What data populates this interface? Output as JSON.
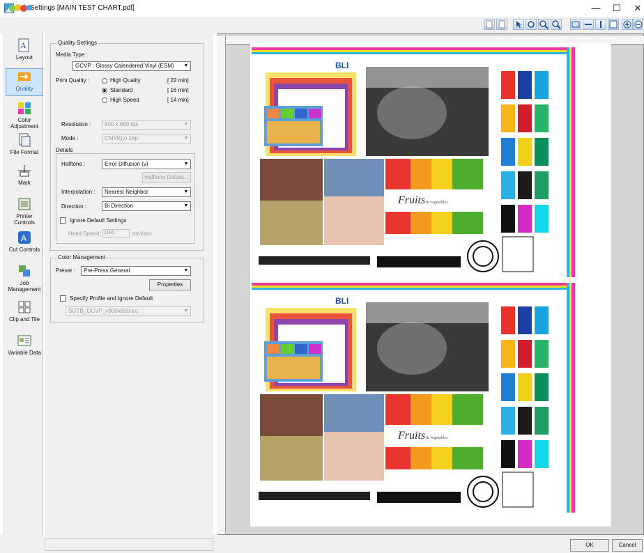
{
  "window": {
    "title": "Job Settings [MAIN TEST CHART.pdf]",
    "minimize": "—",
    "maximize": "☐",
    "close": "✕"
  },
  "toolbar": {
    "icons": [
      "page-prev-icon",
      "page-next-icon",
      "pointer-icon",
      "rotate-icon",
      "zoom-in-icon",
      "zoom-out-icon",
      "fit-page-icon",
      "fit-width-icon",
      "fit-height-icon",
      "grid-icon",
      "zoom-plus-icon",
      "zoom-minus-icon"
    ]
  },
  "sidebar": {
    "items": [
      {
        "label": "Layout",
        "icon": "layout-icon"
      },
      {
        "label": "Quality",
        "icon": "quality-icon",
        "selected": true
      },
      {
        "label": "Color Adjustment",
        "icon": "color-adjustment-icon"
      },
      {
        "label": "File Format",
        "icon": "file-format-icon"
      },
      {
        "label": "Mark",
        "icon": "mark-icon"
      },
      {
        "label": "Printer Controls",
        "icon": "printer-controls-icon"
      },
      {
        "label": "Cut Controls",
        "icon": "cut-controls-icon"
      },
      {
        "label": "Job Management",
        "icon": "job-management-icon"
      },
      {
        "label": "Clip and Tile",
        "icon": "clip-tile-icon"
      },
      {
        "label": "Variable Data",
        "icon": "variable-data-icon"
      }
    ]
  },
  "quality": {
    "group_title": "Quality Settings",
    "media_type_label": "Media Type :",
    "media_type_value": "GCVP : Glossy Calendered Vinyl (ESM)",
    "print_quality_label": "Print Quality :",
    "options": [
      {
        "label": "High Quality",
        "time": "[ 22 min]",
        "selected": false
      },
      {
        "label": "Standard",
        "time": "[ 16 min]",
        "selected": true
      },
      {
        "label": "High Speed",
        "time": "[ 14 min]",
        "selected": false
      }
    ],
    "resolution_label": "Resolution :",
    "resolution_value": "900 x 600 dpi",
    "mode_label": "Mode :",
    "mode_value": "CMYK(v) 16p",
    "details_title": "Details",
    "halftone_label": "Halftone :",
    "halftone_value": "Error Diffusion (v)",
    "halftone_button": "Halftone Details...",
    "interpolation_label": "Interpolation :",
    "interpolation_value": "Nearest Neighbor",
    "direction_label": "Direction :",
    "direction_value": "Bi Direction",
    "ignore_default": "Ignore Default Settings",
    "head_speed_label": "Head Speed:",
    "head_speed_value": "1185",
    "head_speed_unit": "mm/sec"
  },
  "color_management": {
    "group_title": "Color Management",
    "preset_label": "Preset :",
    "preset_value": "Pre-Press General",
    "properties_button": "Properties",
    "specify_profile": "Specify Profile and Ignore Default",
    "profile_value": "SGTB_GCVP_v900x600.icc"
  },
  "preview": {
    "sheets": [
      {
        "brand": "BLI",
        "fruits_text": "Fruits",
        "fruits_sub": "& vegetables"
      },
      {
        "brand": "BLI",
        "fruits_text": "Fruits",
        "fruits_sub": "& vegetables"
      }
    ],
    "swatch_colors": [
      "#e8322b",
      "#1d3fa6",
      "#1aa3e0",
      "#f7b516",
      "#d11f2f",
      "#29b36a",
      "#1e7fd4",
      "#f2cf1a",
      "#0a8f5a",
      "#2bb0e6",
      "#1b1b1b",
      "#1d9e63",
      "#111111",
      "#d62bc4",
      "#13d7e8"
    ]
  },
  "dialog": {
    "ok": "OK",
    "cancel": "Cancel"
  }
}
